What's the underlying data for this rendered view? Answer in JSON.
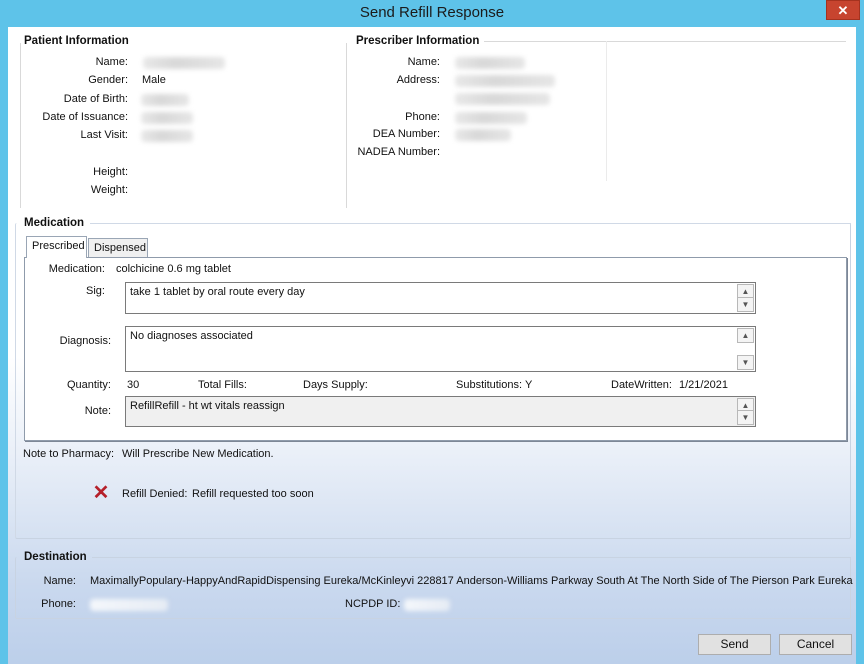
{
  "window": {
    "title": "Send Refill Response",
    "close_glyph": "✕"
  },
  "patient": {
    "section_title": "Patient Information",
    "labels": {
      "name": "Name:",
      "gender": "Gender:",
      "dob": "Date of Birth:",
      "issuance": "Date of Issuance:",
      "last_visit": "Last Visit:",
      "height": "Height:",
      "weight": "Weight:"
    },
    "gender": "Male"
  },
  "prescriber": {
    "section_title": "Prescriber Information",
    "labels": {
      "name": "Name:",
      "address": "Address:",
      "phone": "Phone:",
      "dea": "DEA Number:",
      "nadea": "NADEA Number:"
    }
  },
  "medication": {
    "section_title": "Medication",
    "tabs": [
      "Prescribed",
      "Dispensed"
    ],
    "labels": {
      "medication": "Medication:",
      "sig": "Sig:",
      "diagnosis": "Diagnosis:",
      "quantity": "Quantity:",
      "total_fills": "Total Fills:",
      "days_supply": "Days Supply:",
      "substitutions": "Substitutions:",
      "date_written": "DateWritten:",
      "note": "Note:"
    },
    "medication": "colchicine 0.6 mg tablet",
    "sig": "take 1 tablet by oral route  every day",
    "diagnosis": "No diagnoses associated",
    "quantity": "30",
    "substitutions": "Y",
    "date_written": "1/21/2021",
    "note": "RefillRefill - ht wt vitals reassign"
  },
  "pharmacy_note": {
    "label": "Note to Pharmacy:",
    "value": "Will Prescribe New Medication."
  },
  "refill_status": {
    "icon": "denied-x-icon",
    "label": "Refill Denied:",
    "value": "Refill requested too soon"
  },
  "destination": {
    "section_title": "Destination",
    "labels": {
      "name": "Name:",
      "phone": "Phone:",
      "ncpdp": "NCPDP ID:"
    },
    "name": "MaximallyPopulary-HappyAndRapidDispensing Eureka/McKinleyvi 228817 Anderson-Williams Parkway South At The North Side of The Pierson Park Eureka McKinleyvi"
  },
  "buttons": {
    "send": "Send",
    "cancel": "Cancel"
  },
  "colors": {
    "titlebar": "#5ec3e9",
    "close": "#c7442f",
    "deny_icon": "#b5202a"
  }
}
